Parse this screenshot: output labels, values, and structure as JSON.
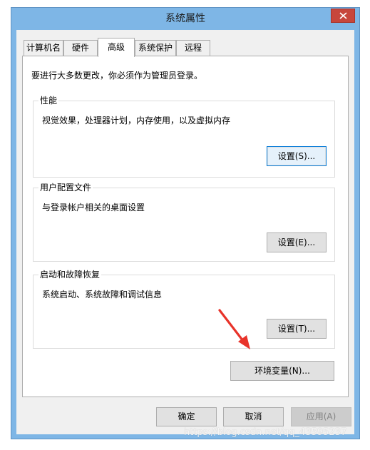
{
  "window": {
    "title": "系统属性",
    "close_icon": "close-icon",
    "colors": {
      "frame": "#7eb6e6",
      "close": "#c7463c",
      "client": "#f0f0f0",
      "accent": "#0078d7"
    }
  },
  "tabs": [
    {
      "label": "计算机名",
      "active": false
    },
    {
      "label": "硬件",
      "active": false
    },
    {
      "label": "高级",
      "active": true
    },
    {
      "label": "系统保护",
      "active": false
    },
    {
      "label": "远程",
      "active": false
    }
  ],
  "advanced": {
    "notice": "要进行大多数更改，你必须作为管理员登录。",
    "performance": {
      "label": "性能",
      "description": "视觉效果，处理器计划，内存使用，以及虚拟内存",
      "button": "设置(S)..."
    },
    "user_profiles": {
      "label": "用户配置文件",
      "description": "与登录帐户相关的桌面设置",
      "button": "设置(E)..."
    },
    "startup_recovery": {
      "label": "启动和故障恢复",
      "description": "系统启动、系统故障和调试信息",
      "button": "设置(T)..."
    },
    "env_vars_button": "环境变量(N)..."
  },
  "footer": {
    "ok": "确定",
    "cancel": "取消",
    "apply": "应用(A)"
  },
  "annotation": {
    "arrow_icon": "red-arrow-icon",
    "color": "#e8332a"
  },
  "watermark": "https://blog.csdn.net/qq_43595237"
}
